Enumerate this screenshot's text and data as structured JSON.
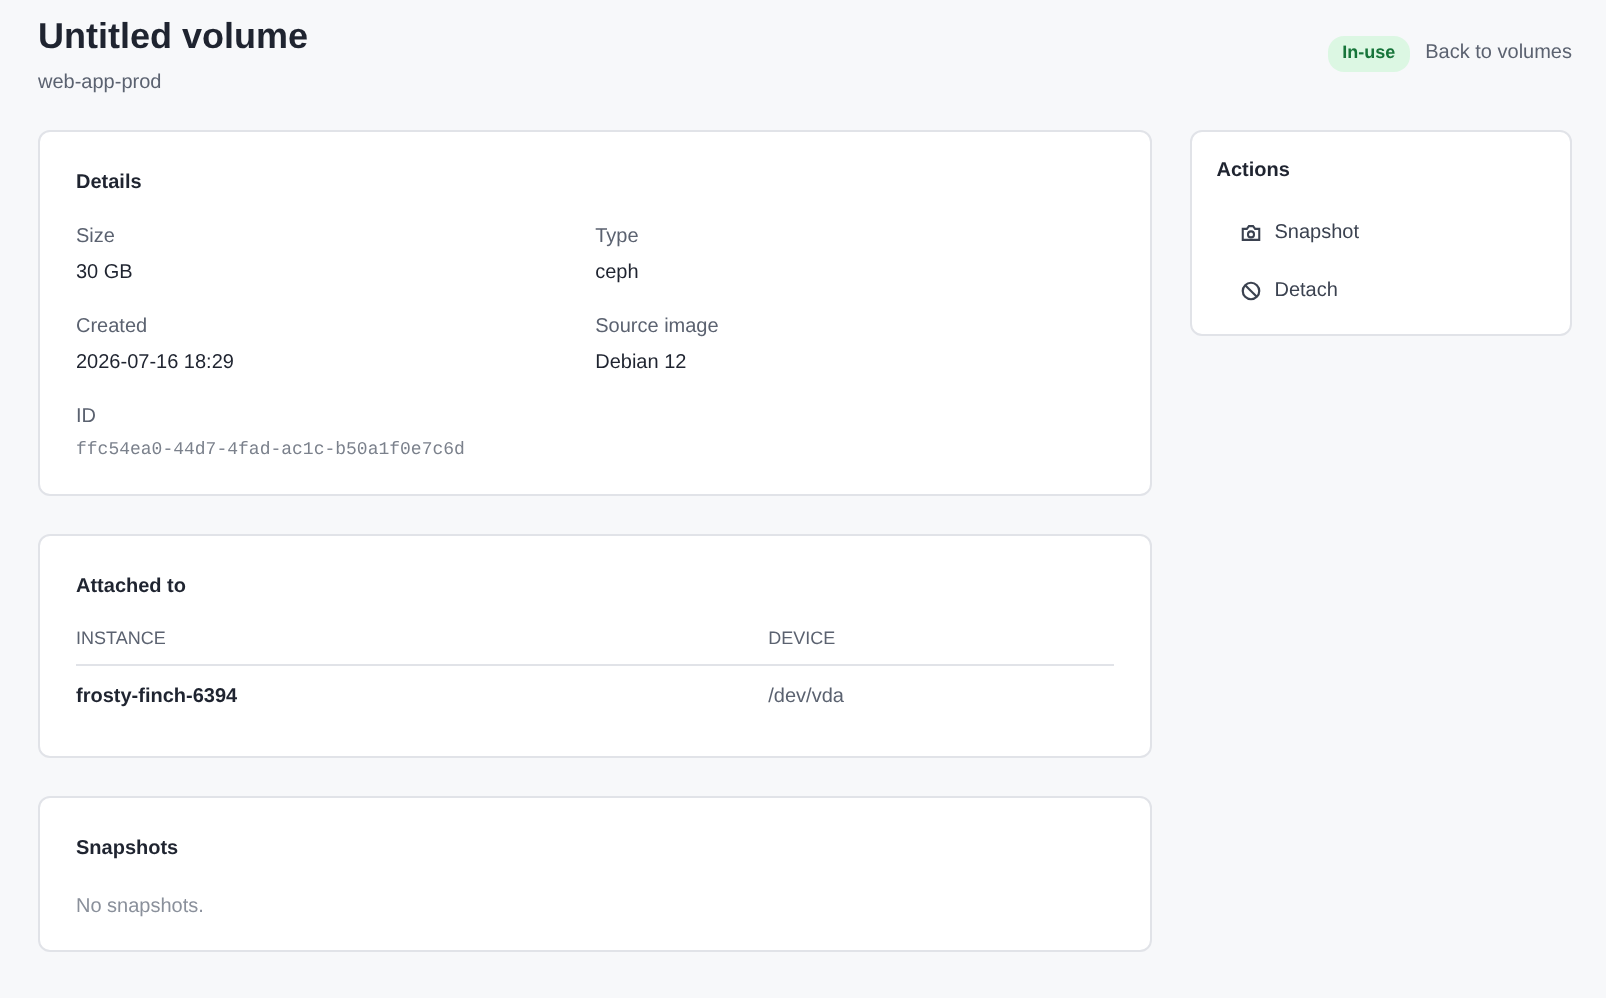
{
  "header": {
    "title": "Untitled volume",
    "subtitle": "web-app-prod",
    "status": "In-use",
    "back_link": "Back to volumes"
  },
  "details": {
    "title": "Details",
    "fields": [
      {
        "label": "Size",
        "value": "30 GB",
        "kind": "text"
      },
      {
        "label": "Type",
        "value": "ceph",
        "kind": "text"
      },
      {
        "label": "Created",
        "value": "2026-07-16 18:29",
        "kind": "text"
      },
      {
        "label": "Source image",
        "value": "Debian 12",
        "kind": "text"
      },
      {
        "label": "ID",
        "value": "ffc54ea0-44d7-4fad-ac1c-b50a1f0e7c6d",
        "kind": "mono"
      }
    ]
  },
  "attached": {
    "title": "Attached to",
    "columns": [
      "INSTANCE",
      "DEVICE"
    ],
    "rows": [
      [
        "frosty-finch-6394",
        "/dev/vda"
      ]
    ]
  },
  "snapshots": {
    "title": "Snapshots",
    "empty": "No snapshots."
  },
  "actions": {
    "title": "Actions",
    "items": [
      {
        "label": "Snapshot",
        "kind": "camera"
      },
      {
        "label": "Detach",
        "kind": "ban"
      }
    ]
  }
}
